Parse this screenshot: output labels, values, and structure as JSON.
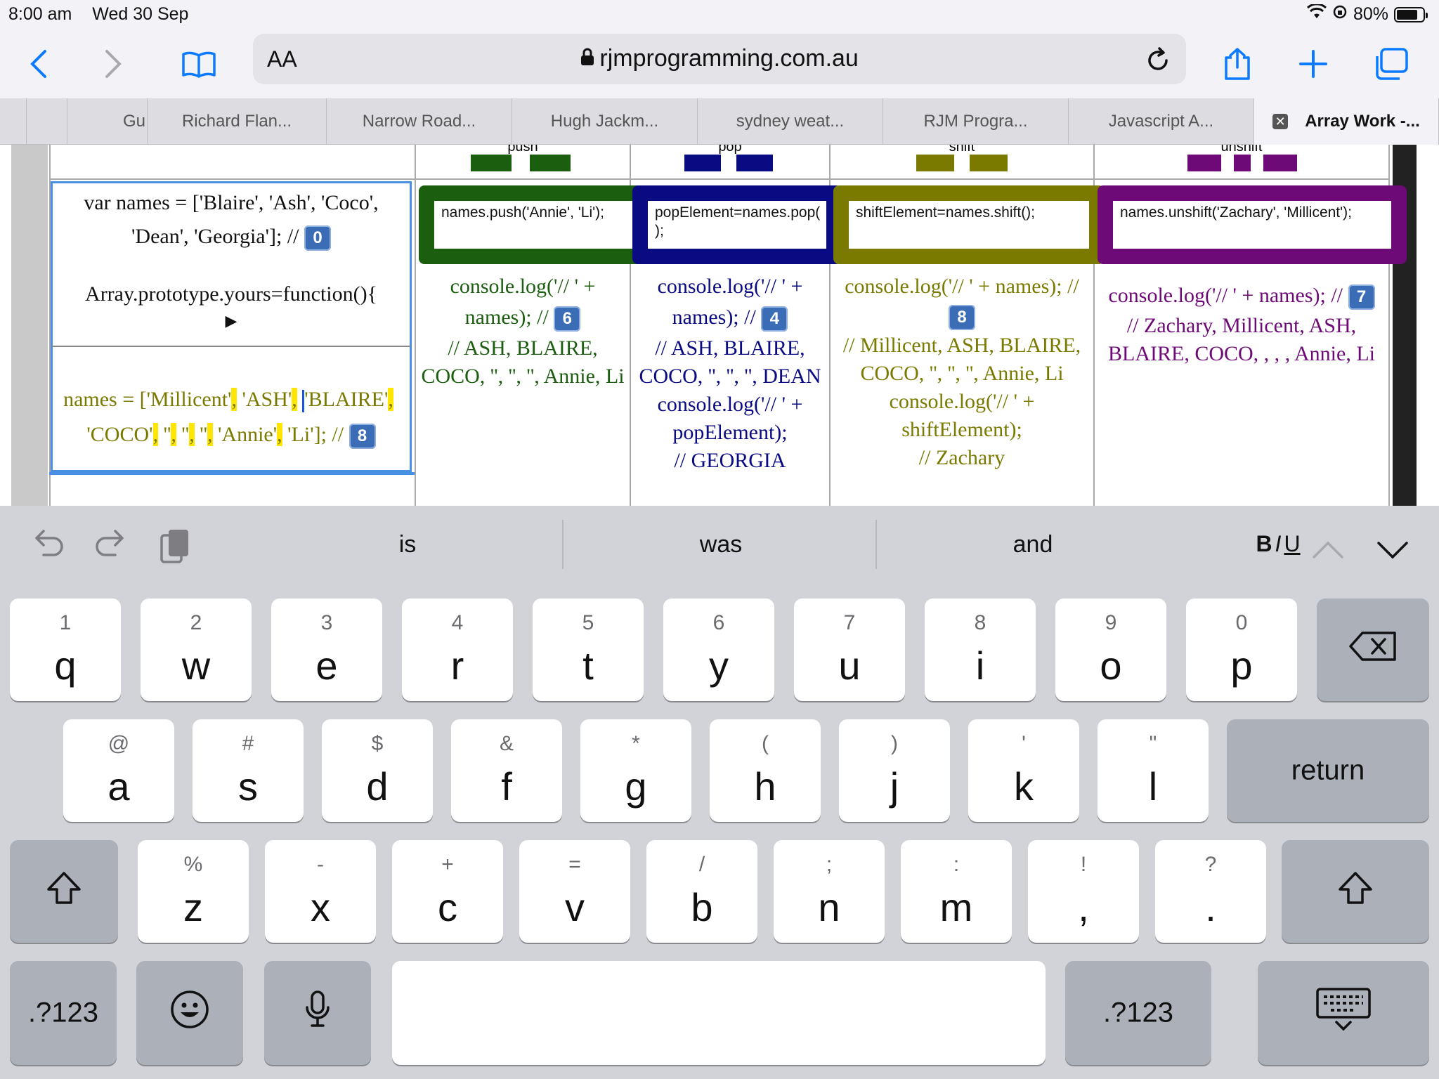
{
  "status_bar": {
    "time": "8:00 am",
    "date": "Wed 30 Sep",
    "battery": "80%",
    "battery_level": 0.8
  },
  "toolbar": {
    "text_size": "AA",
    "url": "rjmprogramming.com.au"
  },
  "tabs": [
    {
      "label": ""
    },
    {
      "label": "Gu"
    },
    {
      "label": "Richard Flan..."
    },
    {
      "label": "Narrow Road..."
    },
    {
      "label": "Hugh Jackm..."
    },
    {
      "label": "sydney weat..."
    },
    {
      "label": "RJM Progra..."
    },
    {
      "label": "Javascript A..."
    },
    {
      "label": "Array Work -..."
    }
  ],
  "page": {
    "headers": {
      "push": "push",
      "pop": "pop",
      "shift": "shift",
      "unshift": "unshift"
    },
    "editor": {
      "line1": "var names = ['Blaire', 'Ash', 'Coco',",
      "line2": "'Dean', 'Georgia']; //",
      "badge0": "0",
      "line3": "Array.prototype.yours=function(){",
      "toggle": "▶",
      "result_open": "names = ['Millicent'",
      "c1": ",",
      "ash": " 'ASH'",
      "c2": ",",
      "blaire": "'BLAIRE'",
      "c3": ",",
      "coco": "'COCO'",
      "c4": ",",
      "q1": " ''",
      "c5": ",",
      "q2": " ''",
      "c6": ",",
      "q3": " ''",
      "c7": ",",
      "annie": " 'Annie'",
      "c8": ",",
      "result_close": " 'Li']; //",
      "badge8": "8"
    },
    "push": {
      "code": "names.push('Annie', 'Li');",
      "log1": "console.log('// ' +",
      "log2": "names); //",
      "badge": "6",
      "result": "// ASH, BLAIRE, COCO, '', '', '', Annie, Li"
    },
    "pop": {
      "code": "popElement=names.pop( );",
      "log1": "console.log('// ' +",
      "log2": "names); //",
      "badge": "4",
      "result": "// ASH, BLAIRE, COCO, '', '', '', DEAN",
      "log3": "console.log('// ' + popElement);",
      "result2": "// GEORGIA"
    },
    "shift": {
      "code": "shiftElement=names.shift();",
      "log1": "console.log('// ' + names); //",
      "badge": "8",
      "result": "// Millicent, ASH, BLAIRE, COCO, '', '', '', Annie, Li",
      "log2": "console.log('// ' + shiftElement);",
      "result2": "// Zachary"
    },
    "unshift": {
      "code": "names.unshift('Zachary', 'Millicent');",
      "log1": "console.log('// ' + names); //",
      "badge": "7",
      "result": "// Zachary, Millicent, ASH, BLAIRE, COCO, , , , Annie, Li"
    }
  },
  "colors": {
    "push": "#1b5e0f",
    "pop": "#0a0a82",
    "shift": "#7a7a00",
    "unshift": "#6e0a78",
    "accent": "#0a7aff"
  },
  "keyboard": {
    "suggestions": [
      "is",
      "was",
      "and"
    ],
    "format": {
      "bold": "B",
      "italic": "I",
      "underline": "U"
    },
    "row1": [
      {
        "k": "q",
        "s": "1"
      },
      {
        "k": "w",
        "s": "2"
      },
      {
        "k": "e",
        "s": "3"
      },
      {
        "k": "r",
        "s": "4"
      },
      {
        "k": "t",
        "s": "5"
      },
      {
        "k": "y",
        "s": "6"
      },
      {
        "k": "u",
        "s": "7"
      },
      {
        "k": "i",
        "s": "8"
      },
      {
        "k": "o",
        "s": "9"
      },
      {
        "k": "p",
        "s": "0"
      }
    ],
    "row2": [
      {
        "k": "a",
        "s": "@"
      },
      {
        "k": "s",
        "s": "#"
      },
      {
        "k": "d",
        "s": "$"
      },
      {
        "k": "f",
        "s": "&"
      },
      {
        "k": "g",
        "s": "*"
      },
      {
        "k": "h",
        "s": "("
      },
      {
        "k": "j",
        "s": ")"
      },
      {
        "k": "k",
        "s": "'"
      },
      {
        "k": "l",
        "s": "\""
      }
    ],
    "row3": [
      {
        "k": "z",
        "s": "%"
      },
      {
        "k": "x",
        "s": "-"
      },
      {
        "k": "c",
        "s": "+"
      },
      {
        "k": "v",
        "s": "="
      },
      {
        "k": "b",
        "s": "/"
      },
      {
        "k": "n",
        "s": ";"
      },
      {
        "k": "m",
        "s": ":"
      },
      {
        "k": ",",
        "s": "!"
      },
      {
        "k": ".",
        "s": "?"
      }
    ],
    "return": "return",
    "numbers": ".?123"
  }
}
